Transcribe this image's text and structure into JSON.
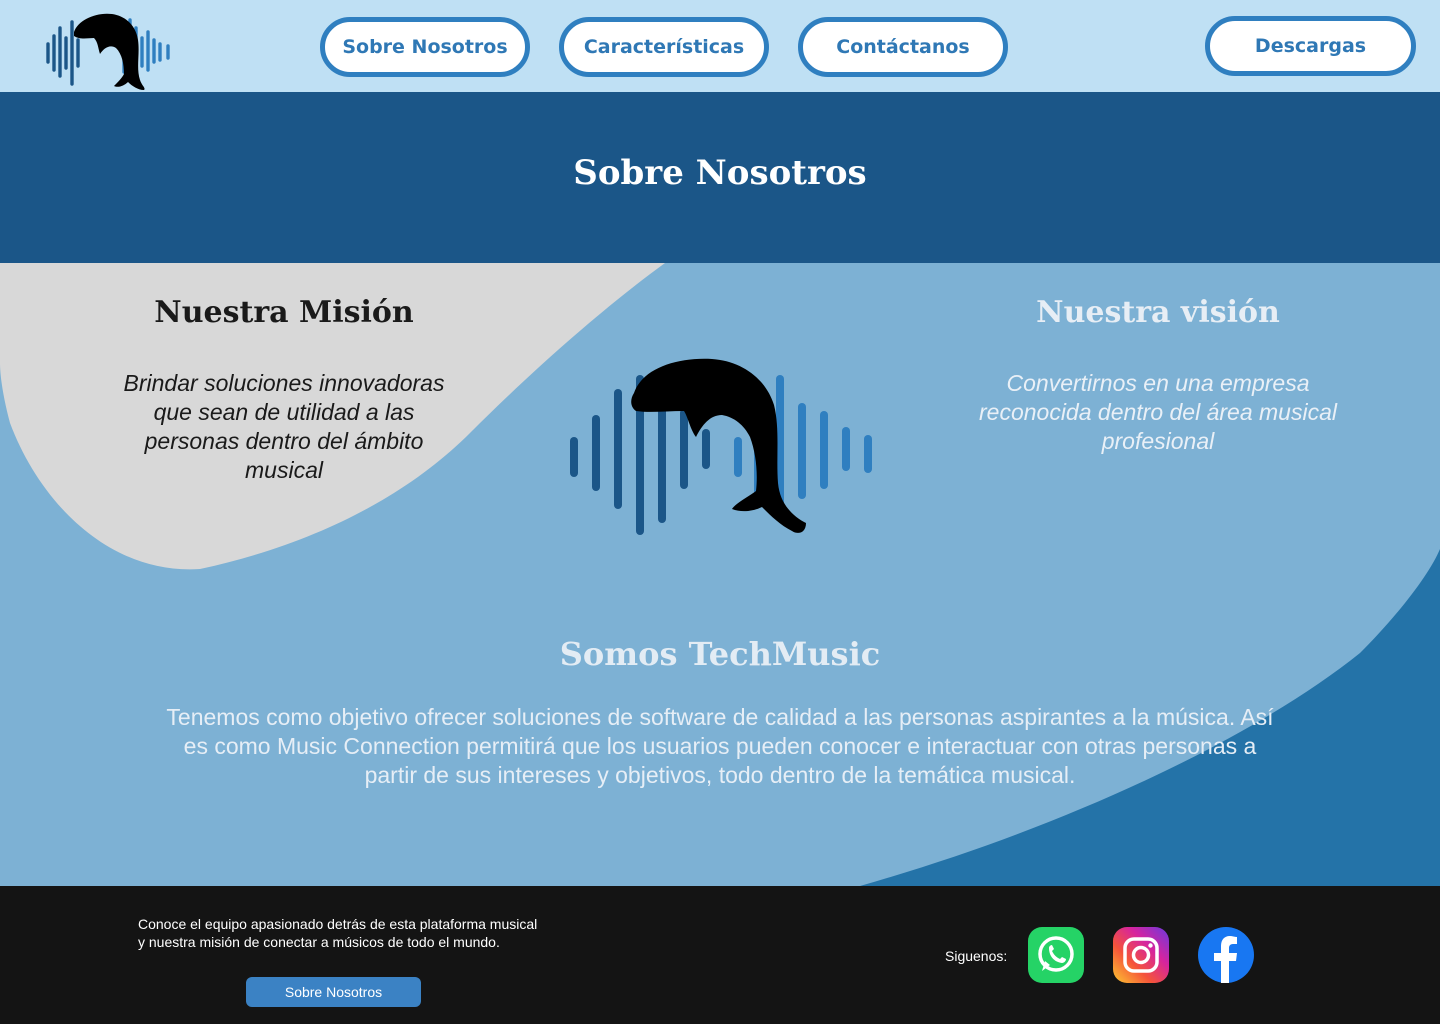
{
  "header": {
    "logo_icon": "dolphin-soundwave-logo",
    "nav": [
      "Sobre Nosotros",
      "Características",
      "Contáctanos"
    ],
    "download_label": "Descargas"
  },
  "banner": {
    "title": "Sobre Nosotros"
  },
  "mision": {
    "title": "Nuestra Misión",
    "text": "Brindar soluciones innovadoras que sean de utilidad a las personas dentro del ámbito musical"
  },
  "vision": {
    "title": "Nuestra visión",
    "text": "Convertirnos en una empresa reconocida dentro del área musical profesional"
  },
  "somos": {
    "title": "Somos TechMusic",
    "text": "Tenemos como objetivo ofrecer soluciones de software de calidad a las personas aspirantes a la música. Así es como Music Connection permitirá que los usuarios pueden conocer e interactuar con otras personas a partir de sus intereses y objetivos, todo dentro de la temática musical."
  },
  "footer": {
    "text": "Conoce el equipo apasionado detrás de esta plataforma musical y nuestra misión de conectar a músicos de todo el mundo.",
    "button_label": "Sobre Nosotros",
    "follow_label": "Siguenos:",
    "social_icons": [
      "whatsapp-icon",
      "instagram-icon",
      "facebook-icon"
    ]
  },
  "colors": {
    "header_bg": "#bfe0f4",
    "banner_bg": "#1b5688",
    "main_bg": "#7db1d4",
    "accent": "#2f7fc0",
    "footer_bg": "#141414"
  }
}
